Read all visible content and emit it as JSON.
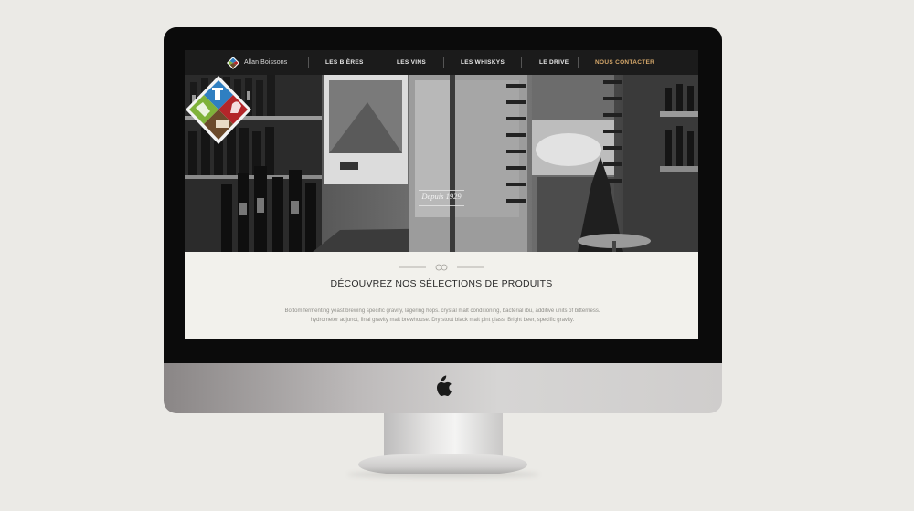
{
  "nav": {
    "brand": "Allan Boissons",
    "items": [
      "LES BIÈRES",
      "LES VINS",
      "LES WHISKYS",
      "LE DRIVE",
      "NOUS CONTACTER"
    ]
  },
  "hero": {
    "tagline": "Depuis 1929"
  },
  "section": {
    "title": "DÉCOUVREZ NOS SÉLECTIONS DE PRODUITS",
    "description": "Bottom fermenting yeast brewing specific gravity, lagering hops. crystal malt conditioning, bacterial ibu, additive units of bitterness. hydrometer adjunct, final gravity malt brewhouse. Dry stout black malt pint glass. Bright beer, specific gravity."
  },
  "colors": {
    "nav_bg": "#1b1b1b",
    "accent": "#d7a96b",
    "logo_blue": "#2f7fc1",
    "logo_red": "#b3262a",
    "logo_green": "#7fb23a",
    "logo_brown": "#6b4a2b",
    "section_bg": "#f2f1ec"
  }
}
